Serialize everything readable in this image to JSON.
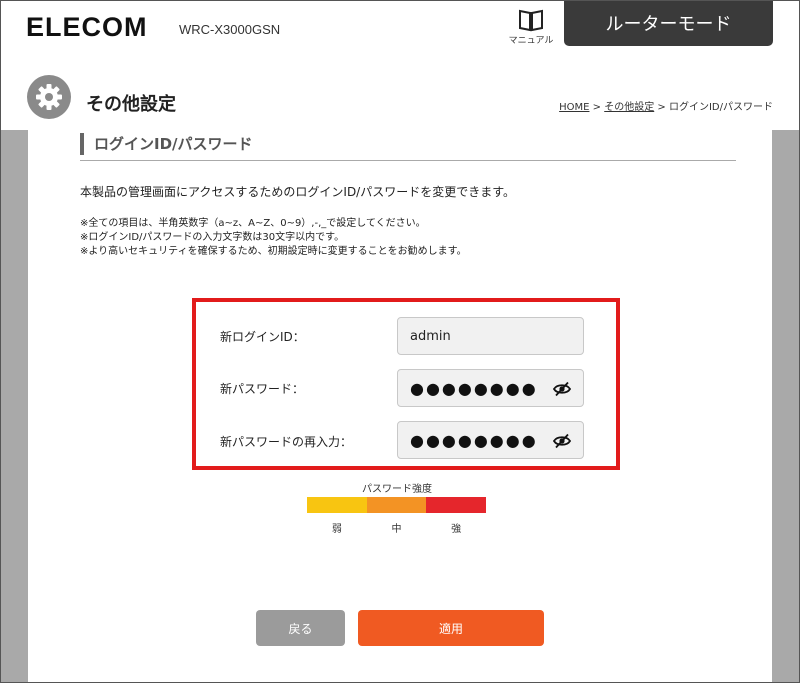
{
  "header": {
    "logo": "ELECOM",
    "model": "WRC-X3000GSN",
    "manual_label": "マニュアル",
    "manual_icon": "book-icon",
    "mode_label": "ルーターモード"
  },
  "page": {
    "title": "その他設定",
    "icon": "gear-icon",
    "breadcrumb": {
      "home": "HOME",
      "sep1": " > ",
      "parent": "その他設定",
      "sep2": " > ",
      "current": "ログインID/パスワード"
    }
  },
  "section": {
    "heading": "ログインID/パスワード",
    "description": "本製品の管理画面にアクセスするためのログインID/パスワードを変更できます。",
    "notes": [
      "※全ての項目は、半角英数字（a~z、A~Z、0~9）,-,_で設定してください。",
      "※ログインID/パスワードの入力文字数は30文字以内です。",
      "※より高いセキュリティを確保するため、初期設定時に変更することをお勧めします。"
    ]
  },
  "form": {
    "login_id_label": "新ログインID：",
    "login_id_value": "admin",
    "password_label": "新パスワード：",
    "password_value": "●●●●●●●●",
    "password_confirm_label": "新パスワードの再入力：",
    "password_confirm_value": "●●●●●●●●",
    "eye_icon": "eye-slash-icon"
  },
  "strength": {
    "label": "パスワード強度",
    "levels": [
      "弱",
      "中",
      "強"
    ],
    "colors": [
      "#f8c511",
      "#f39324",
      "#e5262c"
    ]
  },
  "buttons": {
    "back": "戻る",
    "apply": "適用"
  },
  "colors": {
    "accent_orange": "#f05a22",
    "highlight_red": "#e21b1b",
    "mode_bg": "#3a3a3a"
  }
}
